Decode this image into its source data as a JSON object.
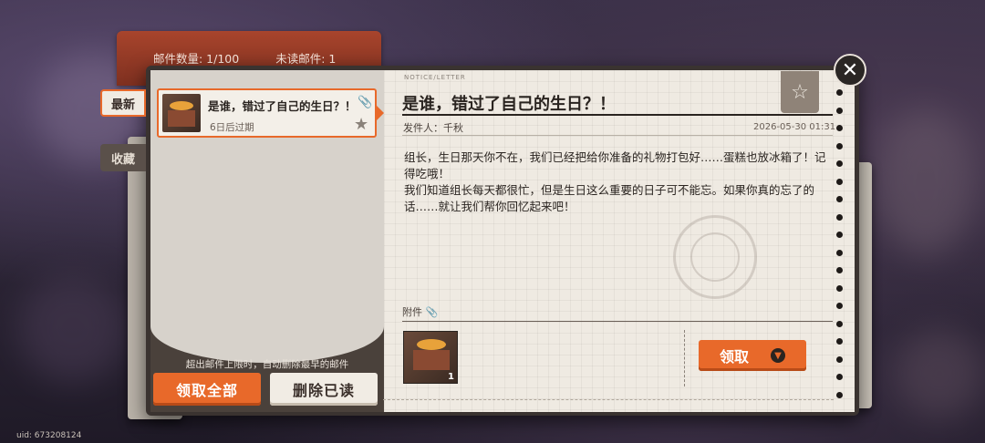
{
  "header": {
    "mail_count_label": "邮件数量: 1/100",
    "unread_label": "未读邮件: 1"
  },
  "tabs": {
    "latest": "最新",
    "favorites": "收藏"
  },
  "mail_list": [
    {
      "title": "是谁，错过了自己的生日？！",
      "expiry": "6日后过期",
      "icon": "cake-icon"
    }
  ],
  "footer": {
    "notice": "超出邮件上限时，自动删除最早的邮件",
    "claim_all": "领取全部",
    "delete_read": "删除已读"
  },
  "mail": {
    "header_code": "NOTICE/LETTER",
    "title": "是谁，错过了自己的生日？！",
    "sender": "发件人：千秋",
    "date": "2026-05-30 01:31",
    "body_lines": [
      "组长，生日那天你不在，我们已经把给你准备的礼物打包好……蛋糕也放冰箱了！记得吃哦！",
      "我们知道组长每天都很忙，但是生日这么重要的日子可不能忘。如果你真的忘了的话……就让我们帮你回忆起来吧！"
    ],
    "attachments_label": "附件",
    "attachment_count": "1",
    "claim_button": "领取"
  },
  "footer_uid": "uid: 673208124",
  "colors": {
    "accent": "#e8692a",
    "paper": "#efeae2",
    "dark": "#2a2420"
  }
}
